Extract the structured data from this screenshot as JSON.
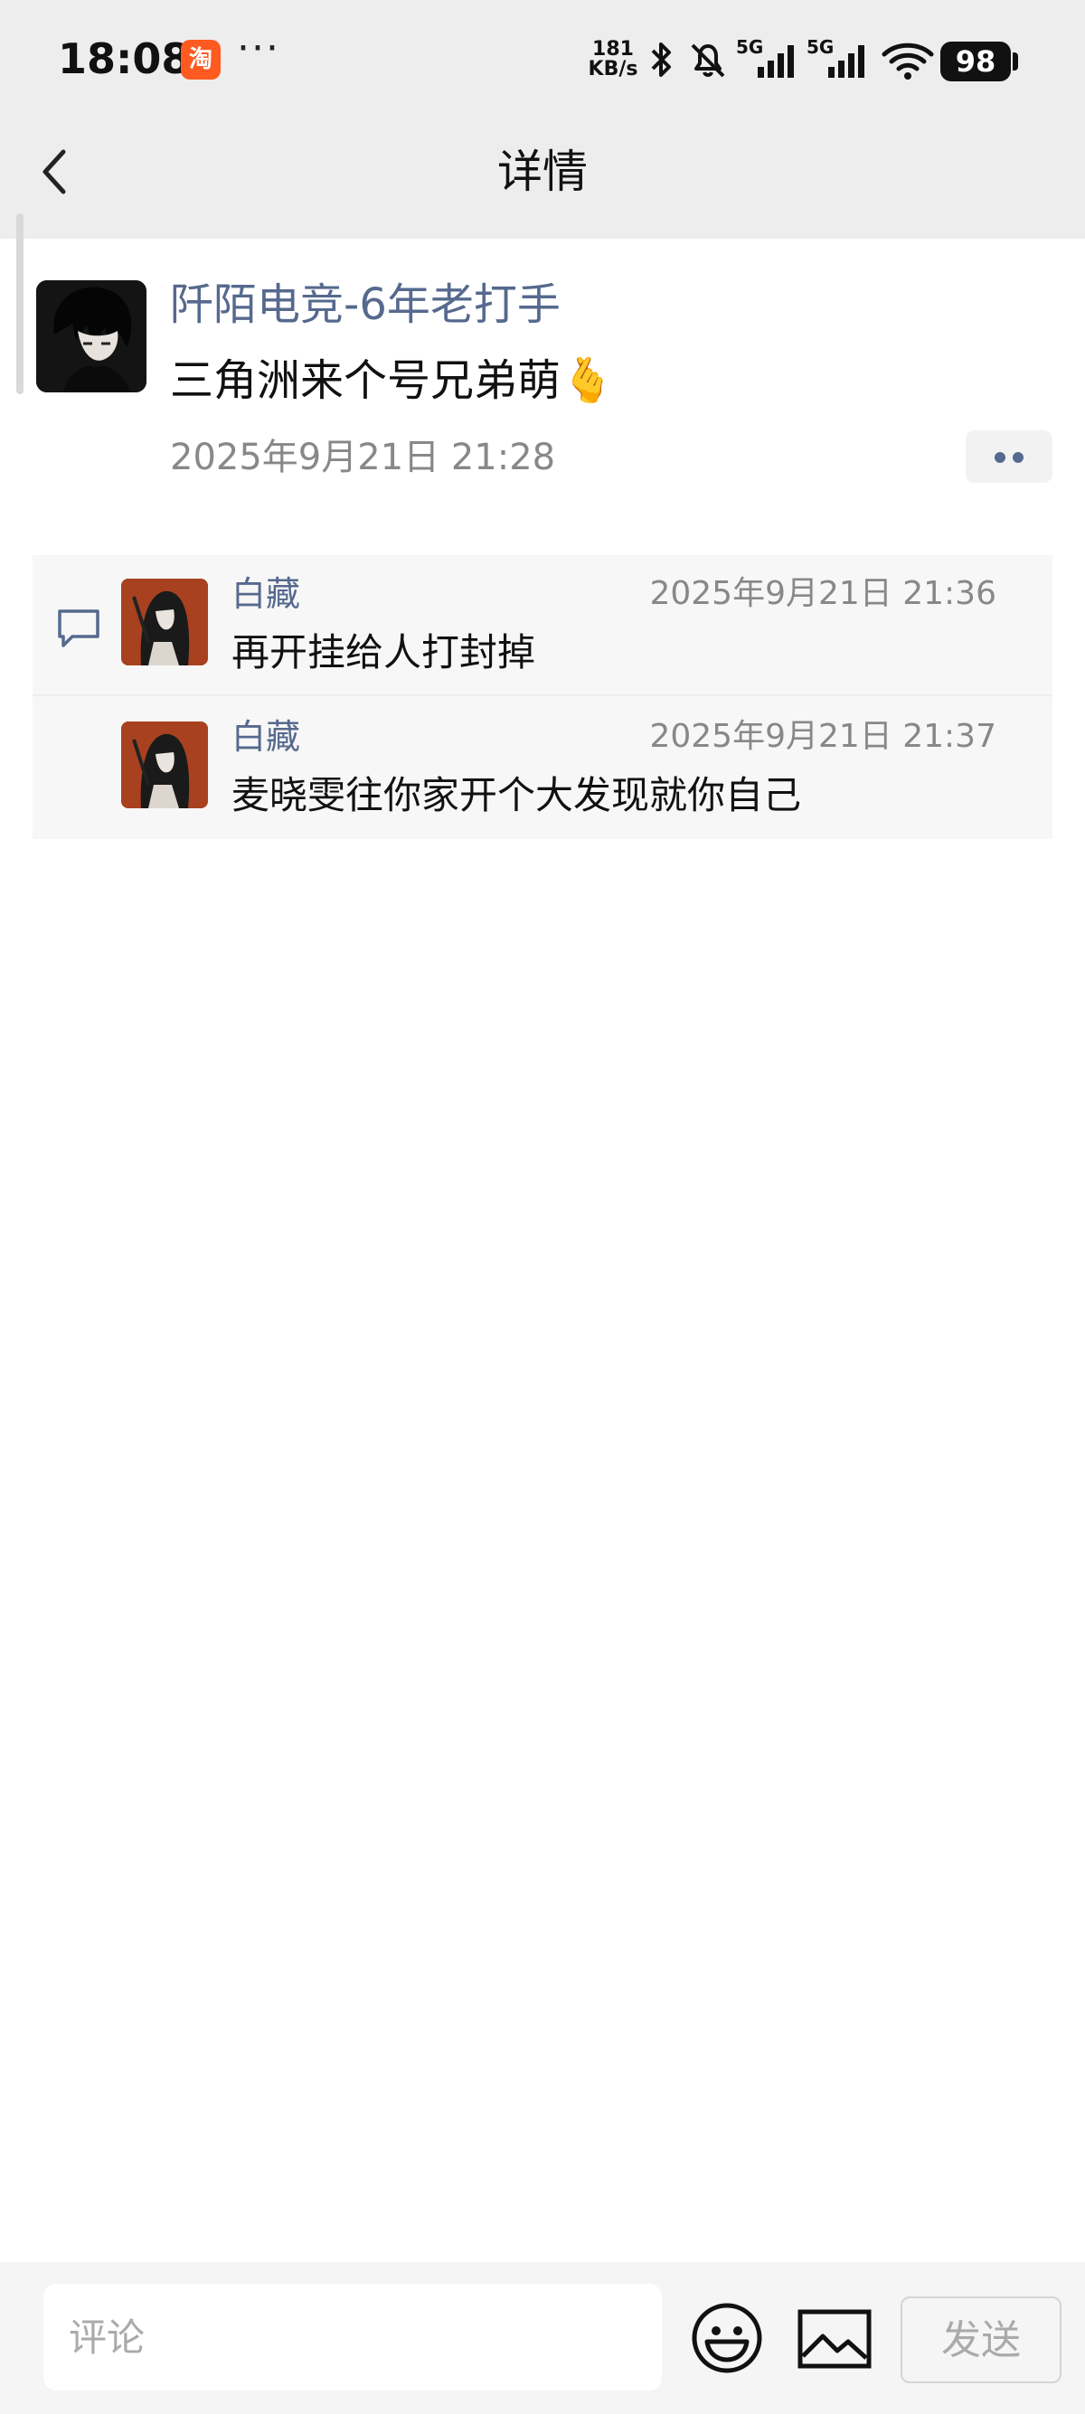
{
  "status_bar": {
    "time": "18:08",
    "app_icon_label": "淘",
    "more": "···",
    "net_speed_value": "181",
    "net_speed_unit": "KB/s",
    "signal_1": "5G",
    "signal_2": "5G",
    "battery": "98"
  },
  "nav": {
    "title": "详情"
  },
  "post": {
    "author": "阡陌电竞-6年老打手",
    "text": "三角洲来个号兄弟萌🫰",
    "time": "2025年9月21日 21:28"
  },
  "comments": [
    {
      "author": "白藏",
      "time": "2025年9月21日 21:36",
      "text": "再开挂给人打封掉"
    },
    {
      "author": "白藏",
      "time": "2025年9月21日 21:37",
      "text": "麦晓雯往你家开个大发现就你自己"
    }
  ],
  "composer": {
    "placeholder": "评论",
    "send_label": "发送"
  },
  "colors": {
    "bar_bg": "#ededed",
    "name_color": "#56698e",
    "comment_bg": "#f7f7f7"
  }
}
